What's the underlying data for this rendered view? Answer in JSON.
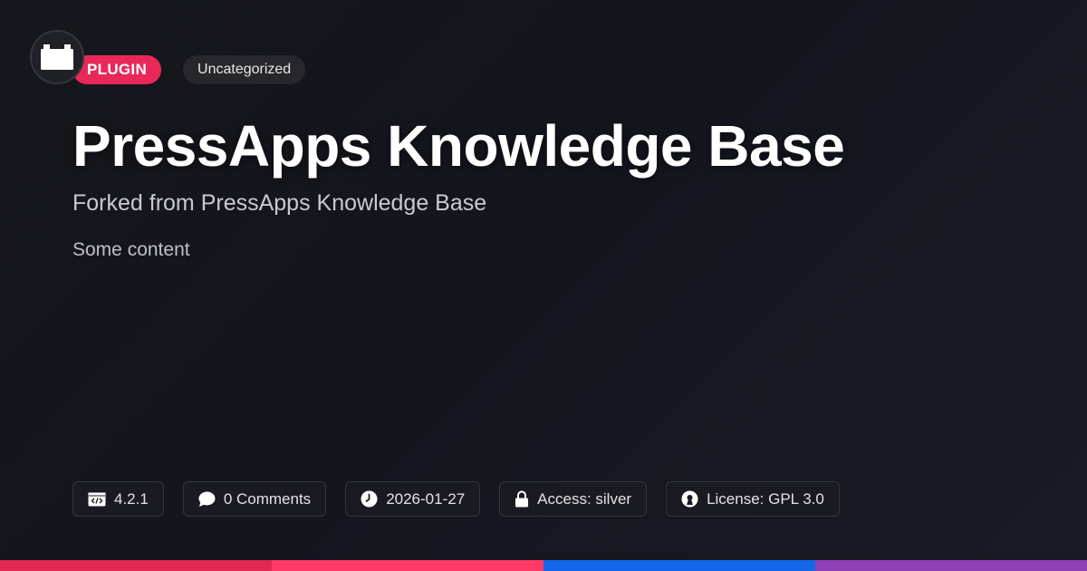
{
  "logo": {
    "icon": "folder-icon"
  },
  "tags": {
    "type": "PLUGIN",
    "category": "Uncategorized",
    "type_color": "#e9285a"
  },
  "title": "PressApps Knowledge Base",
  "subtitle": "Forked from PressApps Knowledge Base",
  "content": "Some content",
  "meta": [
    {
      "icon": "code-window-icon",
      "text": "4.2.1"
    },
    {
      "icon": "comment-bubble-icon",
      "text": "0 Comments"
    },
    {
      "icon": "clock-icon",
      "text": "2026-01-27"
    },
    {
      "icon": "lock-icon",
      "text": "Access: silver"
    },
    {
      "icon": "open-source-icon",
      "text": "License: GPL 3.0"
    }
  ],
  "bottom_bar_colors": [
    "#e02a54",
    "#ff3a68",
    "#1468e8",
    "#8e3fb6"
  ]
}
